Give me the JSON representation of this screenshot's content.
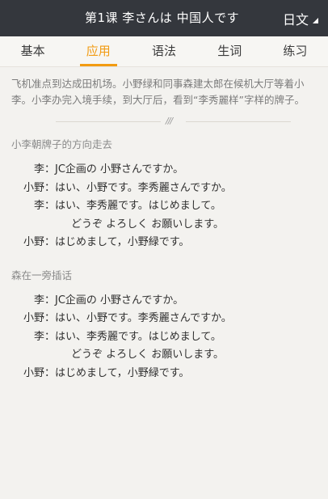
{
  "header": {
    "title": "第1课 李さんは 中国人です",
    "lang_label": "日文"
  },
  "tabs": [
    {
      "label": "基本"
    },
    {
      "label": "应用",
      "active": true
    },
    {
      "label": "语法"
    },
    {
      "label": "生词"
    },
    {
      "label": "练习"
    }
  ],
  "intro": "飞机准点到达成田机场。小野绿和同事森建太郎在候机大厅等着小李。小李办完入境手续，到大厅后，看到“李秀麗样”字样的牌子。",
  "divider_mark": "///",
  "sections": [
    {
      "title": "小李朝牌子的方向走去",
      "lines": [
        {
          "speaker": "李",
          "text": "JC企画の 小野さんですか。"
        },
        {
          "speaker": "小野",
          "text": "はい、小野です。李秀麗さんですか。"
        },
        {
          "speaker": "李",
          "text": "はい、李秀麗です。はじめまして。"
        },
        {
          "speaker": "",
          "text": "どうぞ よろしく お願いします。"
        },
        {
          "speaker": "小野",
          "text": "はじめまして，小野緑です。"
        }
      ]
    },
    {
      "title": "森在一旁插话",
      "lines": [
        {
          "speaker": "李",
          "text": "JC企画の 小野さんですか。"
        },
        {
          "speaker": "小野",
          "text": "はい、小野です。李秀麗さんですか。"
        },
        {
          "speaker": "李",
          "text": "はい、李秀麗です。はじめまして。"
        },
        {
          "speaker": "",
          "text": "どうぞ よろしく お願いします。"
        },
        {
          "speaker": "小野",
          "text": "はじめまして，小野緑です。"
        }
      ]
    }
  ],
  "colors": {
    "header_bg": "#34373d",
    "accent": "#f29b12",
    "page_bg": "#f3f2ef"
  }
}
